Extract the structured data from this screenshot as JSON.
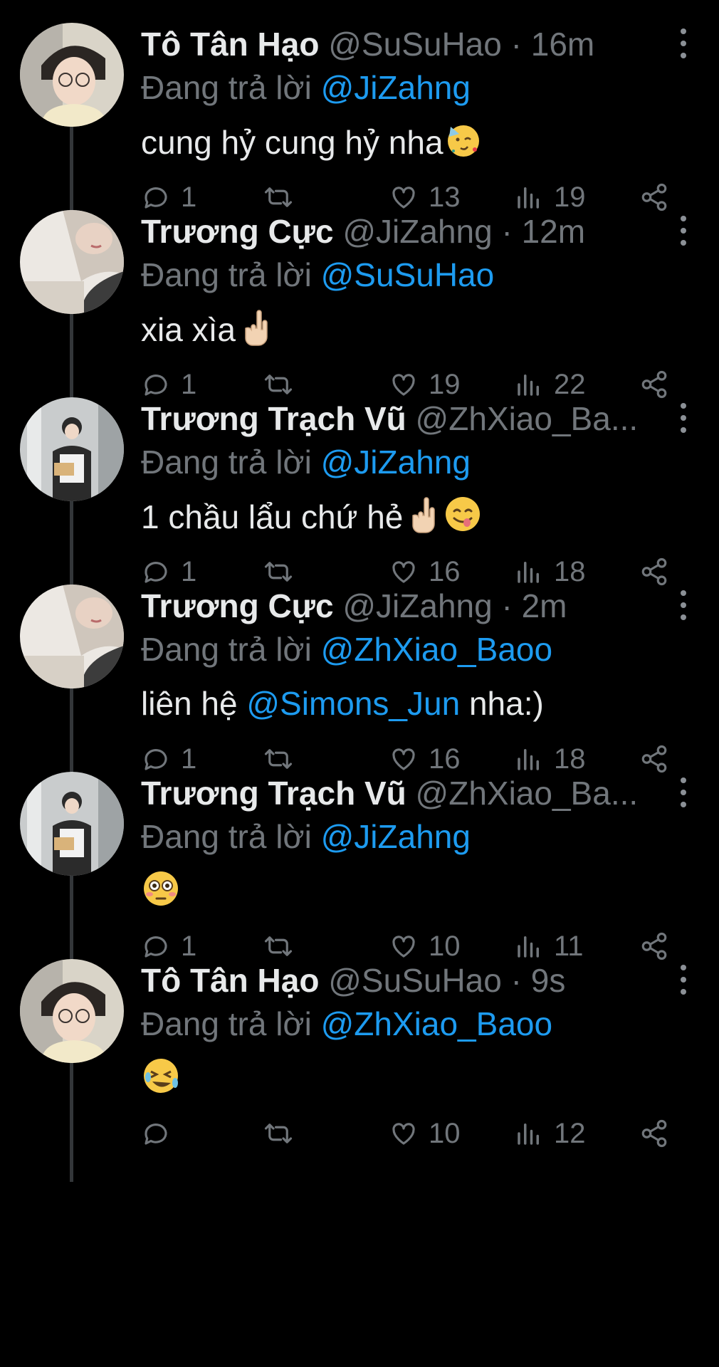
{
  "tweets": [
    {
      "name": "Tô Tân Hạo",
      "handle": "@SuSuHao",
      "time": "· 16m",
      "replying_prefix": "Đang trả lời",
      "replying_to": "@JiZahng",
      "text": "cung hỷ cung hỷ nha",
      "emoji": [
        "partying-face-emoji"
      ],
      "replies": "1",
      "retweets": "",
      "likes": "13",
      "views": "19",
      "avatar": "avatar-hao"
    },
    {
      "name": "Trương Cực",
      "handle": "@JiZahng",
      "time": "· 12m",
      "replying_prefix": "Đang trả lời",
      "replying_to": "@SuSuHao",
      "text": "xia xìa",
      "emoji": [
        "rock-on-hand-emoji"
      ],
      "replies": "1",
      "retweets": "",
      "likes": "19",
      "views": "22",
      "avatar": "avatar-cuc"
    },
    {
      "name": "Trương Trạch Vũ",
      "handle": "@ZhXiao_Ba...",
      "time": "",
      "replying_prefix": "Đang trả lời",
      "replying_to": "@JiZahng",
      "text": "1 chầu lẩu chứ hẻ",
      "emoji": [
        "rock-on-hand-emoji",
        "yum-face-emoji"
      ],
      "replies": "1",
      "retweets": "",
      "likes": "16",
      "views": "18",
      "avatar": "avatar-vu"
    },
    {
      "name": "Trương Cực",
      "handle": "@JiZahng",
      "time": "· 2m",
      "replying_prefix": "Đang trả lời",
      "replying_to": "@ZhXiao_Baoo",
      "text_before": "liên hệ ",
      "text_mention": "@Simons_Jun",
      "text_after": " nha:)",
      "replies": "1",
      "retweets": "",
      "likes": "16",
      "views": "18",
      "avatar": "avatar-cuc"
    },
    {
      "name": "Trương Trạch Vũ",
      "handle": "@ZhXiao_Ba...",
      "time": "",
      "replying_prefix": "Đang trả lời",
      "replying_to": "@JiZahng",
      "text": "",
      "emoji": [
        "flushed-face-emoji"
      ],
      "replies": "1",
      "retweets": "",
      "likes": "10",
      "views": "11",
      "avatar": "avatar-vu"
    },
    {
      "name": "Tô Tân Hạo",
      "handle": "@SuSuHao",
      "time": "· 9s",
      "replying_prefix": "Đang trả lời",
      "replying_to": "@ZhXiao_Baoo",
      "text": "",
      "emoji": [
        "rolling-laughing-face-emoji"
      ],
      "replies": "",
      "retweets": "",
      "likes": "10",
      "views": "12",
      "avatar": "avatar-hao"
    }
  ],
  "colors": {
    "background": "#000000",
    "text": "#e7e9ea",
    "muted": "#71767b",
    "link": "#1d9bf0",
    "thread_line": "#333639"
  }
}
